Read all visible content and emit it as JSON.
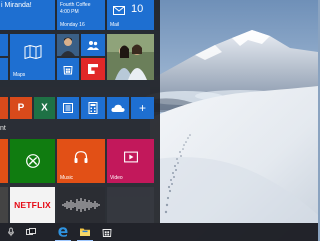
{
  "start_menu": {
    "greeting_tile": {
      "text": "i Miranda!"
    },
    "calendar_tile": {
      "line1": "Fourth Coffee",
      "line2": "4:00 PM",
      "date": "Monday 16"
    },
    "mail_tile": {
      "label": "Mail",
      "count": "10"
    },
    "maps_tile": {
      "label": "Maps"
    },
    "section_play": {
      "label": "nt"
    },
    "xbox_tile": {
      "label": ""
    },
    "music_tile": {
      "label": "Music"
    },
    "video_tile": {
      "label": "Video"
    },
    "netflix_tile": {
      "logo": "NETFLIX"
    },
    "store_tile": {
      "icon": "store-icon"
    },
    "flipboard_tile": {
      "icon": "flipboard-icon"
    },
    "photos_tile": {
      "icon": "photos-icon"
    },
    "people_tile": {
      "icon": "people-icon"
    },
    "onedrive_tile": {
      "icon": "onedrive-icon"
    },
    "calculator_tile": {
      "icon": "calculator-icon"
    },
    "add_tile": {
      "icon": "plus-icon"
    }
  },
  "taskbar": {
    "items": [
      "microphone-icon",
      "task-view-icon",
      "edge-icon",
      "file-explorer-icon",
      "store-icon"
    ]
  },
  "colors": {
    "accent_blue": "#1e6fd1",
    "office_orange": "#d84a1b",
    "office_green": "#1e7145",
    "office_purple": "#7a2a8a",
    "xbox_green": "#107c10",
    "music_orange": "#e25016",
    "video_red": "#c2185b",
    "netflix_red": "#e50914"
  }
}
